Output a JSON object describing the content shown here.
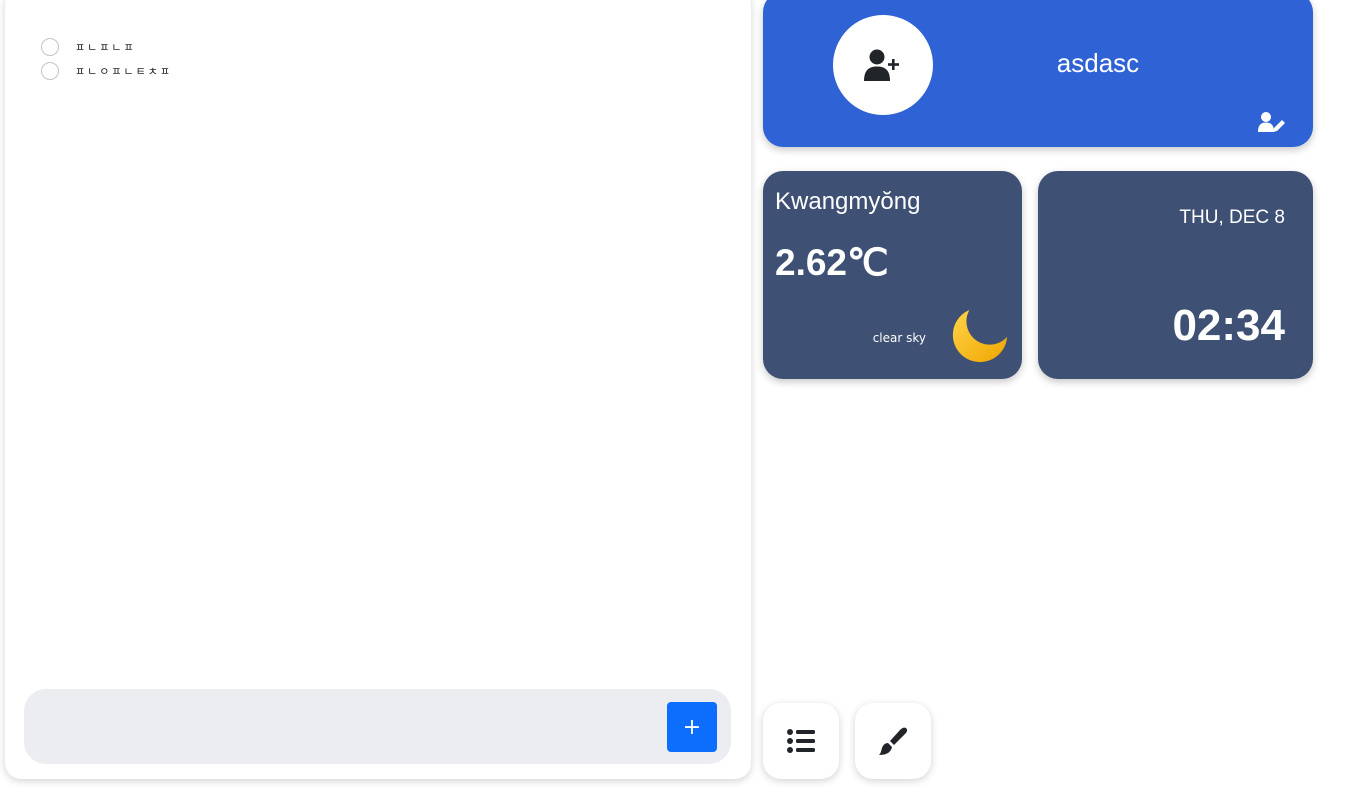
{
  "todo": {
    "items": [
      {
        "text": "ㅍㄴㅍㄴㅍ"
      },
      {
        "text": "ㅍㄴㅇㅍㄴㅌㅊㅍ"
      }
    ],
    "input_value": "",
    "add_label": "+"
  },
  "profile": {
    "name": "asdasc",
    "avatar_icon": "user-plus-icon",
    "edit_icon": "user-pen-icon"
  },
  "weather": {
    "city": "Kwangmyŏng",
    "temperature": "2.62℃",
    "description": "clear sky",
    "icon": "crescent-moon-icon"
  },
  "clock": {
    "date": "THU, DEC 8",
    "time": "02:34"
  },
  "toolbar": {
    "list_icon": "list-icon",
    "brush_icon": "paintbrush-icon"
  },
  "colors": {
    "profile_bg": "#2f62d5",
    "card_bg": "#3e5073",
    "accent_button": "#0d6efd",
    "input_bar_bg": "#ecedf1"
  }
}
